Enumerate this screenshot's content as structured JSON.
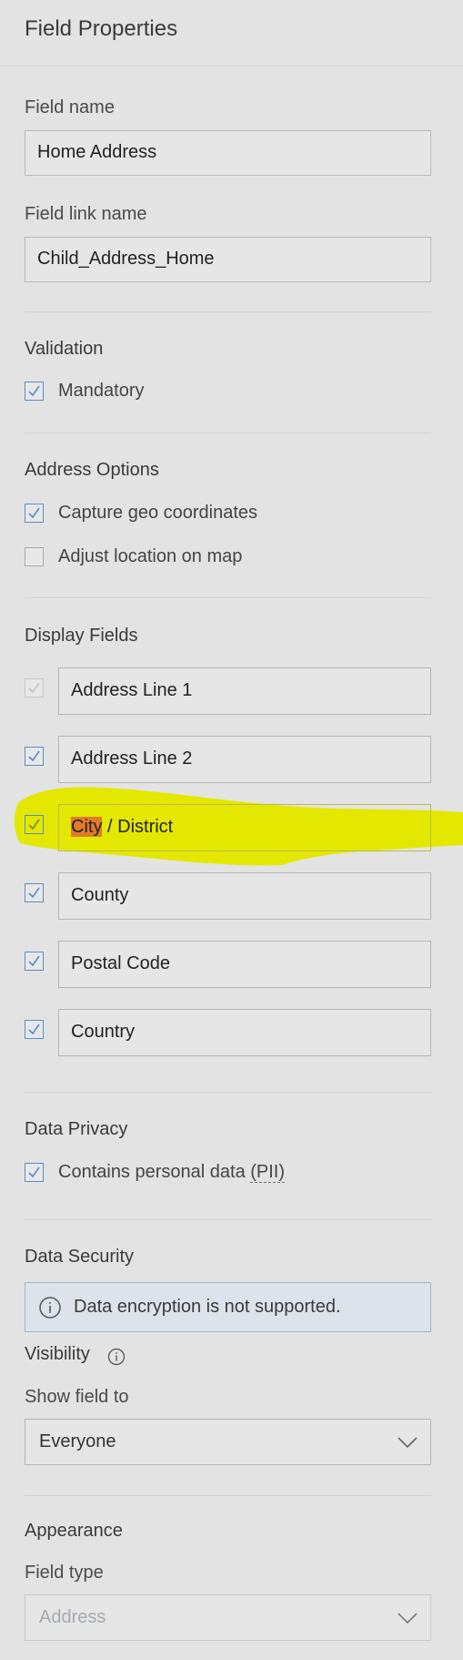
{
  "header": {
    "title": "Field Properties"
  },
  "field_name": {
    "label": "Field name",
    "value": "Home Address"
  },
  "field_link_name": {
    "label": "Field link name",
    "value": "Child_Address_Home"
  },
  "validation": {
    "title": "Validation",
    "mandatory": {
      "label": "Mandatory",
      "checked": true
    }
  },
  "address_options": {
    "title": "Address Options",
    "capture_geo": {
      "label": "Capture geo coordinates",
      "checked": true
    },
    "adjust_location": {
      "label": "Adjust location on map",
      "checked": false
    }
  },
  "display_fields": {
    "title": "Display Fields",
    "items": [
      {
        "label": "Address Line 1",
        "checked": true,
        "disabled": true
      },
      {
        "label": "Address Line 2",
        "checked": true,
        "disabled": false
      },
      {
        "label_highlighted": "City",
        "label_rest": " / District",
        "checked": true,
        "disabled": false
      },
      {
        "label": "County",
        "checked": true,
        "disabled": false
      },
      {
        "label": "Postal Code",
        "checked": true,
        "disabled": false
      },
      {
        "label": "Country",
        "checked": true,
        "disabled": false
      }
    ]
  },
  "data_privacy": {
    "title": "Data Privacy",
    "pii": {
      "label_prefix": "Contains personal data ",
      "label_abbr": "(PII)",
      "checked": true
    }
  },
  "data_security": {
    "title": "Data Security",
    "info_message": "Data encryption is not supported."
  },
  "visibility": {
    "title": "Visibility",
    "show_field_to_label": "Show field to",
    "show_field_to_value": "Everyone"
  },
  "appearance": {
    "title": "Appearance",
    "field_type_label": "Field type",
    "field_type_value": "Address"
  },
  "colors": {
    "accent_check": "#5b8dc4",
    "highlighter": "#e4e800",
    "word_highlight": "#e07b2a"
  }
}
